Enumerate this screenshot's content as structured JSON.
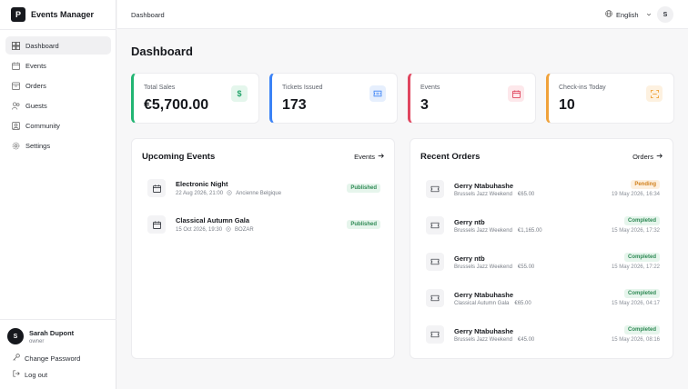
{
  "app": {
    "name": "Events Manager",
    "logo_letter": "P"
  },
  "sidebar": {
    "items": [
      {
        "label": "Dashboard",
        "icon": "dashboard-icon",
        "active": true
      },
      {
        "label": "Events",
        "icon": "calendar-icon"
      },
      {
        "label": "Orders",
        "icon": "orders-icon"
      },
      {
        "label": "Guests",
        "icon": "guests-icon"
      },
      {
        "label": "Community",
        "icon": "community-icon"
      },
      {
        "label": "Settings",
        "icon": "gear-icon"
      }
    ],
    "user": {
      "initial": "S",
      "name": "Sarah Dupont",
      "role": "owner"
    },
    "change_password": "Change Password",
    "logout": "Log out"
  },
  "topbar": {
    "breadcrumb": "Dashboard",
    "language": "English",
    "avatar_initial": "S"
  },
  "page": {
    "title": "Dashboard"
  },
  "stats": [
    {
      "label": "Total Sales",
      "value": "€5,700.00",
      "accent": "#22b573",
      "icon": "dollar-icon",
      "glyph": "$"
    },
    {
      "label": "Tickets Issued",
      "value": "173",
      "accent": "#3b82f6",
      "icon": "ticket-icon",
      "glyph": ""
    },
    {
      "label": "Events",
      "value": "3",
      "accent": "#e0465f",
      "icon": "calendar-icon",
      "glyph": ""
    },
    {
      "label": "Check-ins Today",
      "value": "10",
      "accent": "#f0a23a",
      "icon": "scan-icon",
      "glyph": ""
    }
  ],
  "upcoming": {
    "title": "Upcoming Events",
    "link": "Events",
    "events": [
      {
        "name": "Electronic Night",
        "date": "22 Aug 2026, 21:00",
        "venue": "Ancienne Belgique",
        "status": "Published"
      },
      {
        "name": "Classical Autumn Gala",
        "date": "15 Oct 2026, 19:30",
        "venue": "BOZAR",
        "status": "Published"
      }
    ]
  },
  "orders": {
    "title": "Recent Orders",
    "link": "Orders",
    "items": [
      {
        "customer": "Gerry Ntabuhashe",
        "event": "Brussels Jazz Weekend",
        "amount": "€65.00",
        "status": "Pending",
        "date": "19 May 2026, 16:34"
      },
      {
        "customer": "Gerry ntb",
        "event": "Brussels Jazz Weekend",
        "amount": "€1,165.00",
        "status": "Completed",
        "date": "15 May 2026, 17:32"
      },
      {
        "customer": "Gerry ntb",
        "event": "Brussels Jazz Weekend",
        "amount": "€55.00",
        "status": "Completed",
        "date": "15 May 2026, 17:22"
      },
      {
        "customer": "Gerry Ntabuhashe",
        "event": "Classical Autumn Gala",
        "amount": "€65.00",
        "status": "Completed",
        "date": "15 May 2026, 04:17"
      },
      {
        "customer": "Gerry Ntabuhashe",
        "event": "Brussels Jazz Weekend",
        "amount": "€45.00",
        "status": "Completed",
        "date": "15 May 2026, 08:16"
      }
    ]
  }
}
